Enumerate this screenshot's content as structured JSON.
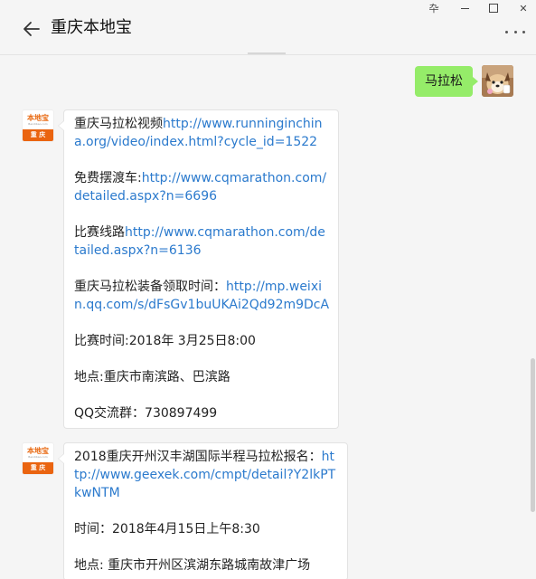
{
  "window": {
    "pin_glyph": "卆",
    "close_glyph": "✕"
  },
  "header": {
    "title": "重庆本地宝"
  },
  "messages": {
    "outgoing": {
      "text": "马拉松"
    },
    "msg1": {
      "avatar_top": "本地宝",
      "avatar_en": "Bendibao.com",
      "avatar_bottom": "重 庆",
      "p1_text": "重庆马拉松视频",
      "p1_link": "http://www.runninginchina.org/video/index.html?cycle_id=1522",
      "p2_text": "免费摆渡车:",
      "p2_link": "http://www.cqmarathon.com/detailed.aspx?n=6696",
      "p3_text": "比赛线路",
      "p3_link": "http://www.cqmarathon.com/detailed.aspx?n=6136",
      "p4_text": "重庆马拉松装备领取时间：",
      "p4_link": "http://mp.weixin.qq.com/s/dFsGv1buUKAi2Qd92m9DcA",
      "p5_text": "比赛时间:2018年 3月25日8:00",
      "p6_text": "地点:重庆市南滨路、巴滨路",
      "p7_text": "QQ交流群：730897499"
    },
    "msg2": {
      "avatar_top": "本地宝",
      "avatar_en": "Bendibao.com",
      "avatar_bottom": "重 庆",
      "p1_text": "2018重庆开州汉丰湖国际半程马拉松报名：",
      "p1_link": "http://www.geexek.com/cmpt/detail?Y2lkPTkwNTM",
      "p2_text": "时间：2018年4月15日上午8:30",
      "p3_text": "地点: 重庆市开州区滨湖东路城南故津广场"
    }
  },
  "icons": {
    "back": "arrow-left-icon",
    "more": "more-horizontal-icon"
  }
}
